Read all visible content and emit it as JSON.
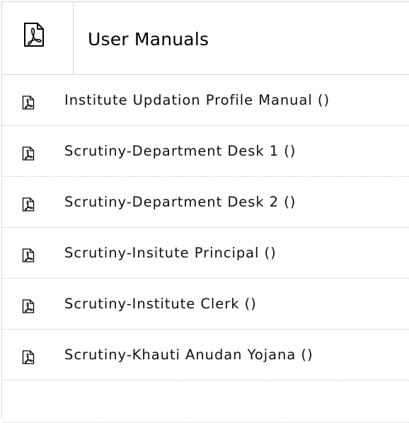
{
  "header": {
    "icon": "pdf-icon",
    "title": "User Manuals"
  },
  "manuals": [
    {
      "label": "Institute Updation Profile Manual ()",
      "icon": "pdf-icon"
    },
    {
      "label": "Scrutiny-Department Desk 1 ()",
      "icon": "pdf-icon"
    },
    {
      "label": "Scrutiny-Department Desk 2 ()",
      "icon": "pdf-icon"
    },
    {
      "label": "Scrutiny-Insitute Principal ()",
      "icon": "pdf-icon"
    },
    {
      "label": "Scrutiny-Institute Clerk ()",
      "icon": "pdf-icon"
    },
    {
      "label": "Scrutiny-Khauti Anudan Yojana ()",
      "icon": "pdf-icon"
    }
  ]
}
